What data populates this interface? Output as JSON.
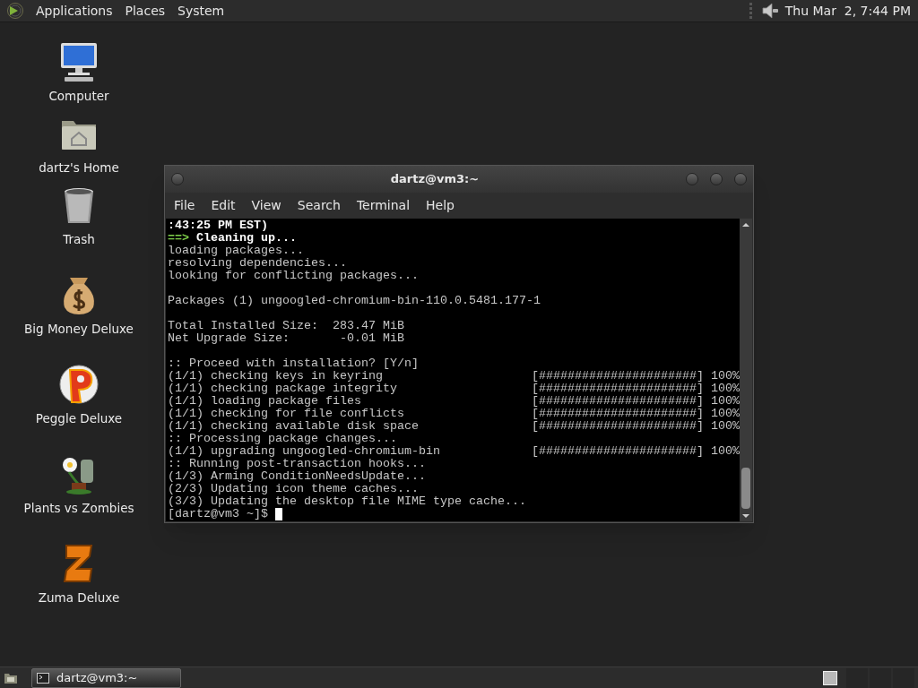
{
  "top_panel": {
    "menus": [
      "Applications",
      "Places",
      "System"
    ],
    "clock": "Thu Mar  2, 7:44 PM"
  },
  "desktop_icons": [
    {
      "label": "Computer"
    },
    {
      "label": "dartz's Home"
    },
    {
      "label": "Trash"
    },
    {
      "label": "Big Money Deluxe"
    },
    {
      "label": "Peggle Deluxe"
    },
    {
      "label": "Plants vs Zombies"
    },
    {
      "label": "Zuma Deluxe"
    }
  ],
  "terminal": {
    "title": "dartz@vm3:~",
    "menu": [
      "File",
      "Edit",
      "View",
      "Search",
      "Terminal",
      "Help"
    ],
    "lines": [
      {
        "kind": "bold",
        "text": ":43:25 PM EST)"
      },
      {
        "kind": "arrow",
        "marker": "==>",
        "text": "Cleaning up..."
      },
      {
        "kind": "plain",
        "text": "loading packages..."
      },
      {
        "kind": "plain",
        "text": "resolving dependencies..."
      },
      {
        "kind": "plain",
        "text": "looking for conflicting packages..."
      },
      {
        "kind": "blank"
      },
      {
        "kind": "plain",
        "text": "Packages (1) ungoogled-chromium-bin-110.0.5481.177-1"
      },
      {
        "kind": "blank"
      },
      {
        "kind": "plain",
        "text": "Total Installed Size:  283.47 MiB"
      },
      {
        "kind": "plain",
        "text": "Net Upgrade Size:       -0.01 MiB"
      },
      {
        "kind": "blank"
      },
      {
        "kind": "plain",
        "text": ":: Proceed with installation? [Y/n]"
      },
      {
        "kind": "progress",
        "text": "(1/1) checking keys in keyring",
        "bar": "[######################]",
        "percent": "100%"
      },
      {
        "kind": "progress",
        "text": "(1/1) checking package integrity",
        "bar": "[######################]",
        "percent": "100%"
      },
      {
        "kind": "progress",
        "text": "(1/1) loading package files",
        "bar": "[######################]",
        "percent": "100%"
      },
      {
        "kind": "progress",
        "text": "(1/1) checking for file conflicts",
        "bar": "[######################]",
        "percent": "100%"
      },
      {
        "kind": "progress",
        "text": "(1/1) checking available disk space",
        "bar": "[######################]",
        "percent": "100%"
      },
      {
        "kind": "plain",
        "text": ":: Processing package changes..."
      },
      {
        "kind": "progress",
        "text": "(1/1) upgrading ungoogled-chromium-bin",
        "bar": "[######################]",
        "percent": "100%"
      },
      {
        "kind": "plain",
        "text": ":: Running post-transaction hooks..."
      },
      {
        "kind": "plain",
        "text": "(1/3) Arming ConditionNeedsUpdate..."
      },
      {
        "kind": "plain",
        "text": "(2/3) Updating icon theme caches..."
      },
      {
        "kind": "plain",
        "text": "(3/3) Updating the desktop file MIME type cache..."
      },
      {
        "kind": "prompt",
        "text": "[dartz@vm3 ~]$"
      }
    ]
  },
  "taskbar": {
    "tasks": [
      {
        "label": "dartz@vm3:~",
        "selected": true
      }
    ]
  }
}
